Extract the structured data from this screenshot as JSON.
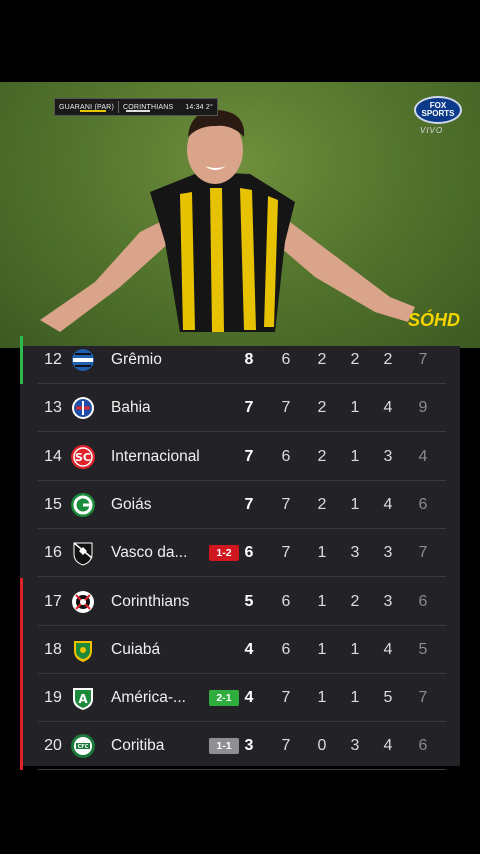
{
  "video": {
    "scorebug": {
      "home": "GUARANI (PAR)",
      "away": "CORINTHIANS",
      "clock": "14:34 2°"
    },
    "broadcaster": {
      "logo_text": "FOX SPORTS",
      "live_label": "VIVO"
    },
    "watermark": "SÓHD"
  },
  "standings": {
    "rows": [
      {
        "pos": "12",
        "team": "Grêmio",
        "crest": "gremio-crest",
        "result": "",
        "pts": "8",
        "pj": "6",
        "w": "2",
        "d": "2",
        "l": "2",
        "last": "7",
        "marker": "#2fb84c",
        "result_color": ""
      },
      {
        "pos": "13",
        "team": "Bahia",
        "crest": "bahia-crest",
        "result": "",
        "pts": "7",
        "pj": "7",
        "w": "2",
        "d": "1",
        "l": "4",
        "last": "9",
        "marker": "",
        "result_color": ""
      },
      {
        "pos": "14",
        "team": "Internacional",
        "crest": "internacional-crest",
        "result": "",
        "pts": "7",
        "pj": "6",
        "w": "2",
        "d": "1",
        "l": "3",
        "last": "4",
        "marker": "",
        "result_color": ""
      },
      {
        "pos": "15",
        "team": "Goiás",
        "crest": "goias-crest",
        "result": "",
        "pts": "7",
        "pj": "7",
        "w": "2",
        "d": "1",
        "l": "4",
        "last": "6",
        "marker": "",
        "result_color": ""
      },
      {
        "pos": "16",
        "team": "Vasco da...",
        "crest": "vasco-crest",
        "result": "1-2",
        "pts": "6",
        "pj": "7",
        "w": "1",
        "d": "3",
        "l": "3",
        "last": "7",
        "marker": "",
        "result_color": "#d0161e"
      },
      {
        "pos": "17",
        "team": "Corinthians",
        "crest": "corinthians-crest",
        "result": "",
        "pts": "5",
        "pj": "6",
        "w": "1",
        "d": "2",
        "l": "3",
        "last": "6",
        "marker": "#e0232b",
        "result_color": ""
      },
      {
        "pos": "18",
        "team": "Cuiabá",
        "crest": "cuiaba-crest",
        "result": "",
        "pts": "4",
        "pj": "6",
        "w": "1",
        "d": "1",
        "l": "4",
        "last": "5",
        "marker": "#e0232b",
        "result_color": ""
      },
      {
        "pos": "19",
        "team": "América-...",
        "crest": "america-crest",
        "result": "2-1",
        "pts": "4",
        "pj": "7",
        "w": "1",
        "d": "1",
        "l": "5",
        "last": "7",
        "marker": "#e0232b",
        "result_color": "#2fae3f"
      },
      {
        "pos": "20",
        "team": "Coritiba",
        "crest": "coritiba-crest",
        "result": "1-1",
        "pts": "3",
        "pj": "7",
        "w": "0",
        "d": "3",
        "l": "4",
        "last": "6",
        "marker": "#e0232b",
        "result_color": "#8e8e93"
      }
    ]
  }
}
